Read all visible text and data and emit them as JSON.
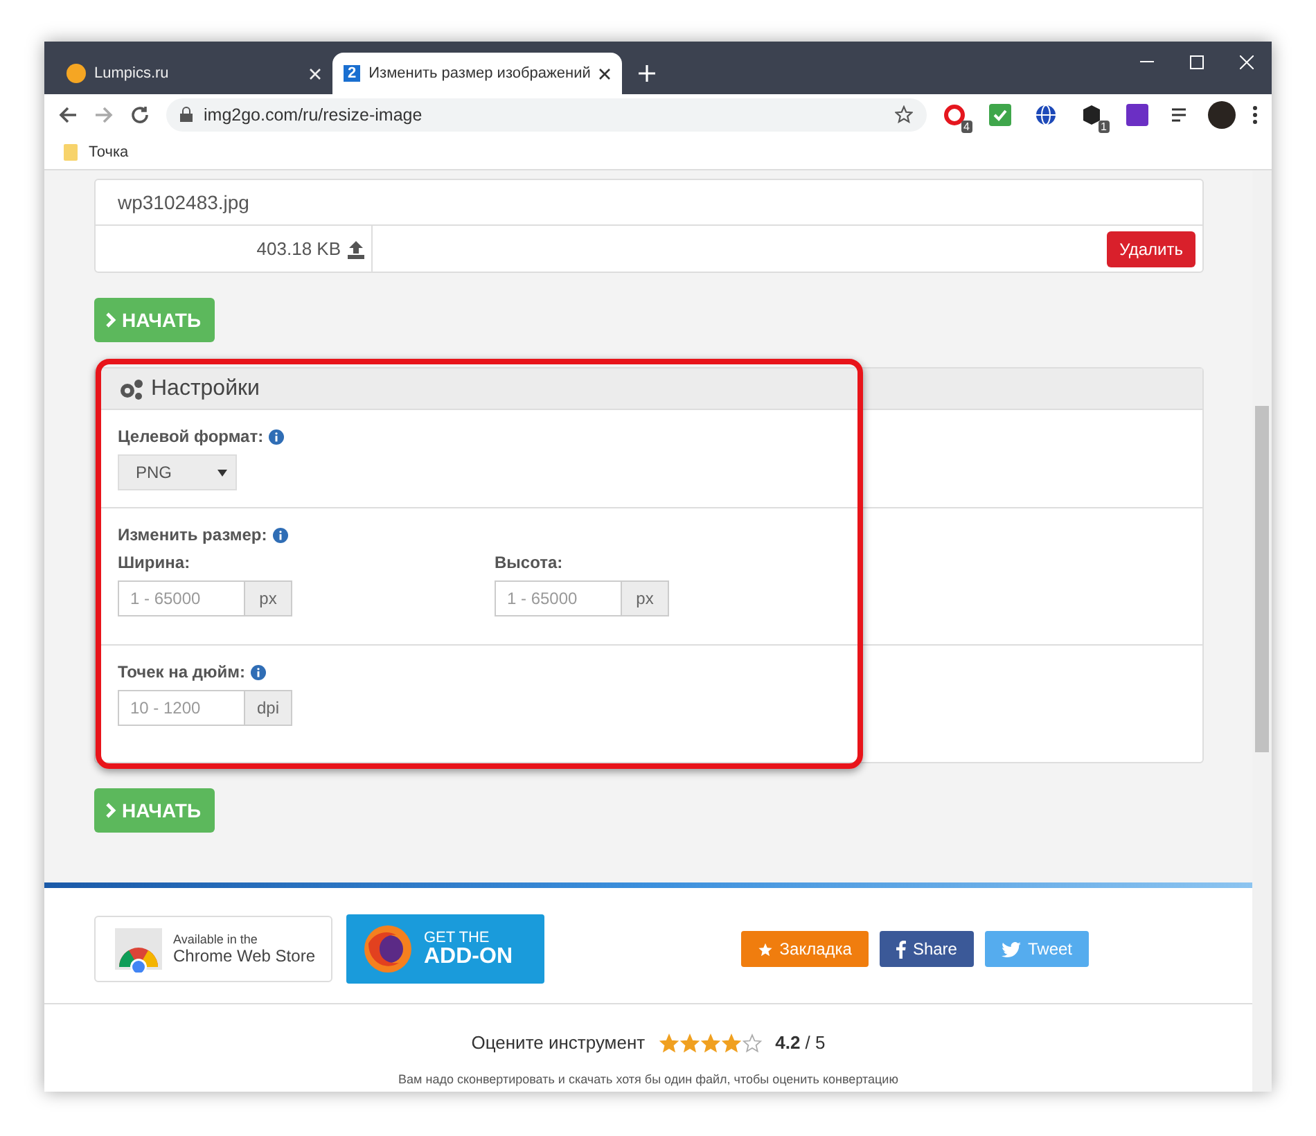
{
  "browser": {
    "tabs": [
      {
        "title": "Lumpics.ru",
        "selected": false,
        "kind": "orange"
      },
      {
        "title": "Изменить размер изображений",
        "selected": true,
        "kind": "numbered",
        "badge": "2"
      }
    ],
    "url": "img2go.com/ru/resize-image",
    "bookmarks": [
      "Точка"
    ],
    "extensions": [
      {
        "kind": "opera",
        "badge": "4"
      },
      {
        "kind": "check"
      },
      {
        "kind": "globe"
      },
      {
        "kind": "cube",
        "badge": "1"
      },
      {
        "kind": "purple"
      }
    ]
  },
  "file": {
    "name": "wp3102483.jpg",
    "size": "403.18 KB",
    "delete_label": "Удалить"
  },
  "start_buttons": [
    "НАЧАТЬ",
    "НАЧАТЬ"
  ],
  "settings": {
    "title": "Настройки",
    "highlighted": true,
    "format": {
      "label": "Целевой формат:",
      "value": "PNG"
    },
    "resize": {
      "label": "Изменить размер:",
      "width": {
        "label": "Ширина:",
        "placeholder": "1 - 65000",
        "unit": "px"
      },
      "height": {
        "label": "Высота:",
        "placeholder": "1 - 65000",
        "unit": "px"
      }
    },
    "dpi": {
      "label": "Точек на дюйм:",
      "placeholder": "10 - 1200",
      "unit": "dpi"
    }
  },
  "footer": {
    "chrome_store": [
      "Available in the",
      "Chrome Web Store"
    ],
    "addon": [
      "GET THE",
      "ADD-ON"
    ],
    "share": [
      {
        "kind": "bookmark",
        "label": "Закладка"
      },
      {
        "kind": "facebook",
        "label": "Share"
      },
      {
        "kind": "twitter",
        "label": "Tweet"
      }
    ],
    "rating": {
      "label": "Оцените инструмент",
      "stars": 4,
      "score": "**4.2** / 5"
    },
    "note": "Вам надо сконвертировать и скачать хотя бы один файл, чтобы оценить конвертацию"
  }
}
